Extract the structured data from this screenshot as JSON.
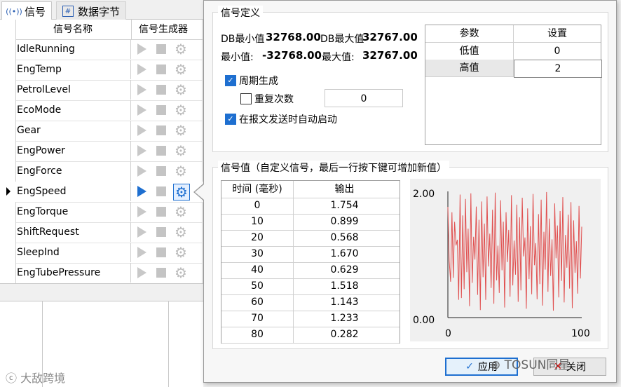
{
  "tabs": [
    {
      "label": "信号",
      "icon": "signal-icon"
    },
    {
      "label": "数据字节",
      "icon": "hash-icon"
    }
  ],
  "grid": {
    "col_name": "信号名称",
    "col_generator": "信号生成器",
    "rows": [
      {
        "name": "IdleRunning",
        "active": false
      },
      {
        "name": "EngTemp",
        "active": false
      },
      {
        "name": "PetrolLevel",
        "active": false
      },
      {
        "name": "EcoMode",
        "active": false
      },
      {
        "name": "Gear",
        "active": false
      },
      {
        "name": "EngPower",
        "active": false
      },
      {
        "name": "EngForce",
        "active": false
      },
      {
        "name": "EngSpeed",
        "active": true
      },
      {
        "name": "EngTorque",
        "active": false
      },
      {
        "name": "ShiftRequest",
        "active": false
      },
      {
        "name": "SleepInd",
        "active": false
      },
      {
        "name": "EngTubePressure",
        "active": false
      }
    ]
  },
  "popup": {
    "def_title": "信号定义",
    "db_min_label": "DB最小值",
    "db_min_value": "32768.00",
    "db_max_label": "DB最大值",
    "db_max_value": "32767.00",
    "min_label": "最小值:",
    "min_value": "-32768.00",
    "max_label": "最大值:",
    "max_value": "32767.00",
    "periodic_label": "周期生成",
    "periodic_checked": true,
    "repeat_label": "重复次数",
    "repeat_checked": false,
    "repeat_value": "0",
    "auto_start_label": "在报文发送时自动启动",
    "auto_start_checked": true,
    "param_table": {
      "col_param": "参数",
      "col_setting": "设置",
      "rows": [
        {
          "param": "低值",
          "setting": "0"
        },
        {
          "param": "高值",
          "setting": "2"
        }
      ]
    },
    "values_title": "信号值（自定义信号，最后一行按下键可增加新值）",
    "value_table": {
      "col_time": "时间 (毫秒)",
      "col_output": "输出",
      "rows": [
        {
          "time": "0",
          "output": "1.754"
        },
        {
          "time": "10",
          "output": "0.899"
        },
        {
          "time": "20",
          "output": "0.568"
        },
        {
          "time": "30",
          "output": "1.670"
        },
        {
          "time": "40",
          "output": "0.629"
        },
        {
          "time": "50",
          "output": "1.518"
        },
        {
          "time": "60",
          "output": "1.143"
        },
        {
          "time": "70",
          "output": "1.233"
        },
        {
          "time": "80",
          "output": "0.282"
        }
      ]
    },
    "apply_label": "应用",
    "close_label": "关闭"
  },
  "chart_data": {
    "type": "line",
    "ylim": [
      0,
      2
    ],
    "xlim": [
      0,
      100
    ],
    "y_ticks": [
      "2.00",
      "0.00"
    ],
    "x_ticks": [
      "0",
      "100"
    ],
    "line_color": "#e05050",
    "series": [
      {
        "values": [
          1.754,
          0.899,
          0.568,
          1.67,
          0.629,
          1.518,
          1.143,
          1.233,
          0.282,
          1.95,
          0.31,
          1.62,
          0.45,
          1.88,
          0.72,
          1.41,
          0.18,
          1.97,
          0.55,
          1.28,
          0.92,
          1.76,
          0.36,
          1.55,
          0.12,
          1.84,
          0.64,
          1.49,
          0.28,
          1.92,
          0.81,
          1.33,
          0.47,
          1.71,
          0.22,
          1.98,
          0.59,
          1.14,
          0.39,
          1.86,
          0.75,
          1.52,
          0.16,
          1.67,
          0.88,
          1.39,
          0.33,
          1.94,
          0.51,
          1.22,
          0.68,
          1.79,
          0.25,
          1.59,
          0.43,
          1.9,
          0.97,
          1.27,
          0.14,
          1.73,
          0.61,
          1.45,
          0.37,
          1.96,
          0.83,
          1.18,
          0.29,
          1.64,
          0.53,
          1.87,
          0.19,
          1.36,
          0.76,
          1.99,
          0.41,
          1.57,
          0.66,
          1.24,
          0.11,
          1.81,
          0.94,
          1.46,
          0.32,
          1.69,
          0.58,
          1.91,
          0.24,
          1.31,
          0.79,
          1.63,
          0.46,
          1.83,
          0.15,
          1.54,
          0.71,
          1.21,
          0.38,
          1.77,
          0.62,
          1.44
        ]
      }
    ]
  },
  "watermarks": {
    "left": "大敌跨境",
    "right": "TOSUN同星"
  },
  "colors": {
    "accent": "#1e6fd0",
    "line": "#e05050"
  }
}
